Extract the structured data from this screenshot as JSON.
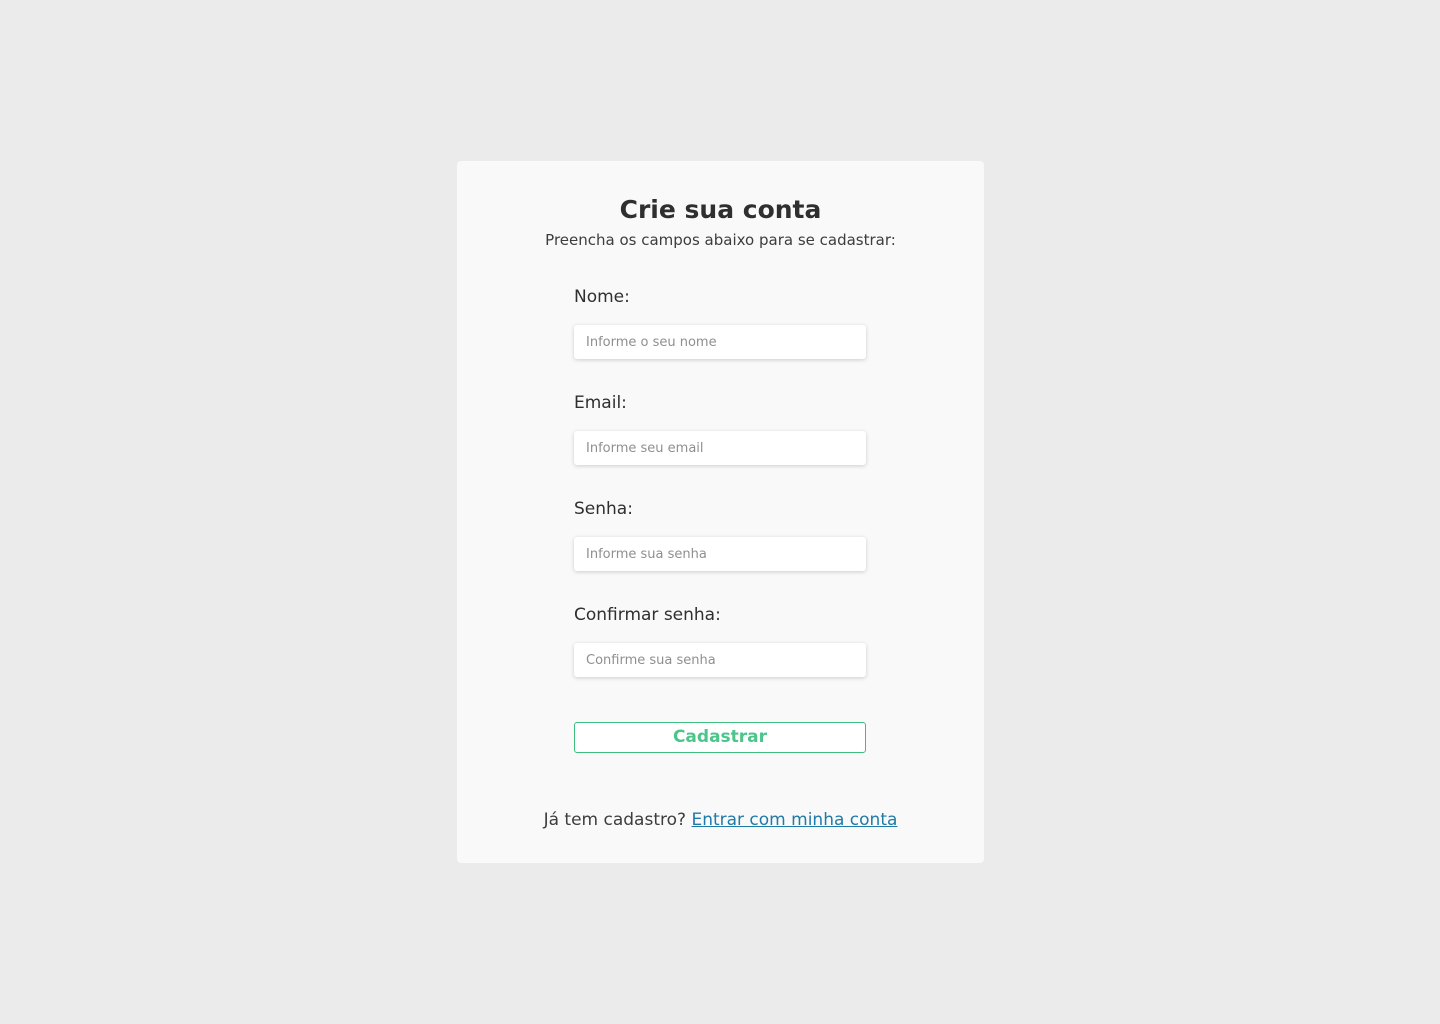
{
  "header": {
    "title": "Crie sua conta",
    "subtitle": "Preencha os campos abaixo para se cadastrar:"
  },
  "form": {
    "fields": [
      {
        "label": "Nome:",
        "placeholder": "Informe o seu nome",
        "value": ""
      },
      {
        "label": "Email:",
        "placeholder": "Informe seu email",
        "value": ""
      },
      {
        "label": "Senha:",
        "placeholder": "Informe sua senha",
        "value": ""
      },
      {
        "label": "Confirmar senha:",
        "placeholder": "Confirme sua senha",
        "value": ""
      }
    ],
    "submit_label": "Cadastrar"
  },
  "footer": {
    "prompt": "Já tem cadastro?",
    "link_label": "Entrar com minha conta"
  },
  "colors": {
    "page_background": "#ebebeb",
    "card_background": "#f9f9f9",
    "accent_green": "#4cc58a",
    "link_blue": "#1f7aa8"
  }
}
